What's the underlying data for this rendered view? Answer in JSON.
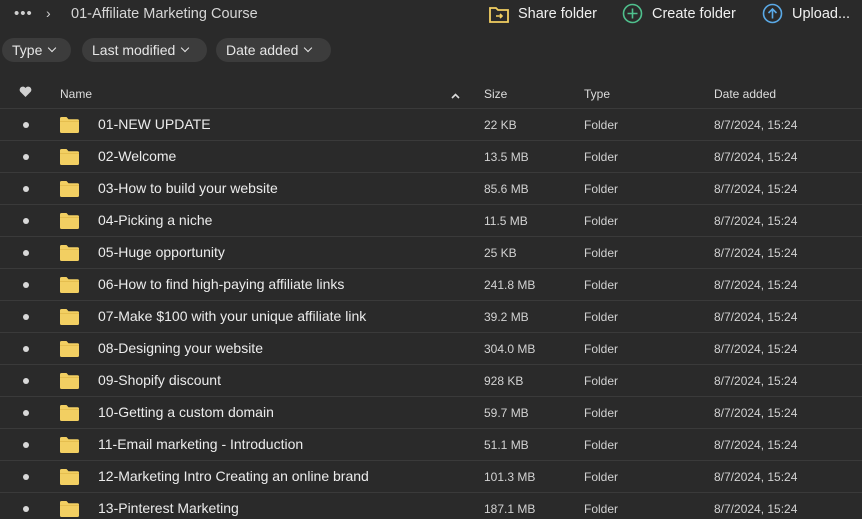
{
  "breadcrumb": {
    "more_label": "•••",
    "separator": "›",
    "current": "01-Affiliate Marketing Course"
  },
  "toolbar": {
    "share_label": "Share folder",
    "create_label": "Create folder",
    "upload_label": "Upload..."
  },
  "filters": {
    "type": "Type",
    "last_modified": "Last modified",
    "date_added": "Date added"
  },
  "columns": {
    "name": "Name",
    "size": "Size",
    "type": "Type",
    "date_added": "Date added"
  },
  "colors": {
    "background": "#2a2a2a",
    "folder": "#f2cf62",
    "accent_green": "#4fc08d",
    "accent_blue": "#5aa9e6"
  },
  "files": [
    {
      "name": "01-NEW UPDATE",
      "size": "22 KB",
      "type": "Folder",
      "date": "8/7/2024, 15:24"
    },
    {
      "name": "02-Welcome",
      "size": "13.5 MB",
      "type": "Folder",
      "date": "8/7/2024, 15:24"
    },
    {
      "name": "03-How to build your website",
      "size": "85.6 MB",
      "type": "Folder",
      "date": "8/7/2024, 15:24"
    },
    {
      "name": "04-Picking a niche",
      "size": "11.5 MB",
      "type": "Folder",
      "date": "8/7/2024, 15:24"
    },
    {
      "name": "05-Huge opportunity",
      "size": "25 KB",
      "type": "Folder",
      "date": "8/7/2024, 15:24"
    },
    {
      "name": "06-How to find high-paying affiliate links",
      "size": "241.8 MB",
      "type": "Folder",
      "date": "8/7/2024, 15:24"
    },
    {
      "name": "07-Make $100 with your unique affiliate link",
      "size": "39.2 MB",
      "type": "Folder",
      "date": "8/7/2024, 15:24"
    },
    {
      "name": "08-Designing your website",
      "size": "304.0 MB",
      "type": "Folder",
      "date": "8/7/2024, 15:24"
    },
    {
      "name": "09-Shopify discount",
      "size": "928 KB",
      "type": "Folder",
      "date": "8/7/2024, 15:24"
    },
    {
      "name": "10-Getting a custom domain",
      "size": "59.7 MB",
      "type": "Folder",
      "date": "8/7/2024, 15:24"
    },
    {
      "name": "11-Email marketing - Introduction",
      "size": "51.1 MB",
      "type": "Folder",
      "date": "8/7/2024, 15:24"
    },
    {
      "name": "12-Marketing Intro Creating an online brand",
      "size": "101.3 MB",
      "type": "Folder",
      "date": "8/7/2024, 15:24"
    },
    {
      "name": "13-Pinterest Marketing",
      "size": "187.1 MB",
      "type": "Folder",
      "date": "8/7/2024, 15:24"
    }
  ]
}
